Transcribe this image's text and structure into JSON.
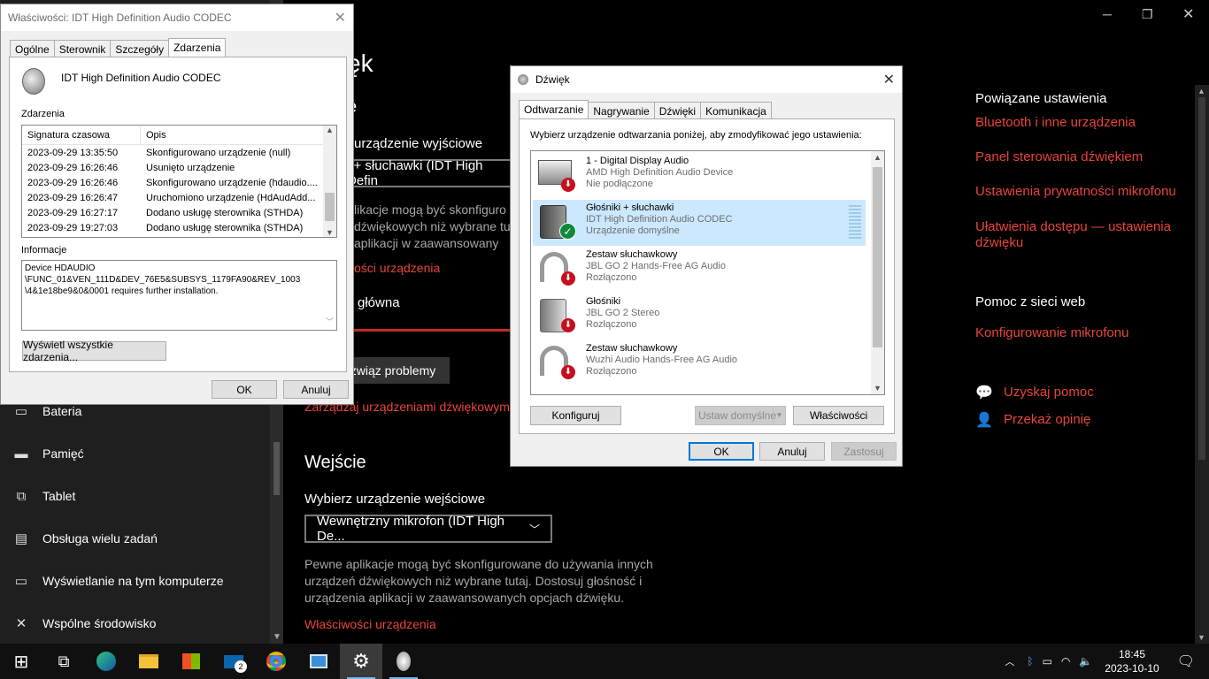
{
  "settings": {
    "heading_partial": "ęk",
    "output_section_partial": "e",
    "choose_output_partial": "urządzenie wyjściowe",
    "output_select_partial": "i + słuchawki (IDT High Defin",
    "output_desc_partial": [
      "likacje mogą być skonfiguro",
      "dźwiękowych niż wybrane tu",
      "aplikacji w zaawansowany"
    ],
    "device_props_partial": "ości urządzenia",
    "volume_partial": "główna",
    "troubleshoot_partial": "związ problemy",
    "manage_devices": "Zarządzaj urządzeniami dźwiękowymi",
    "input_heading": "Wejście",
    "choose_input": "Wybierz urządzenie wejściowe",
    "input_select": "Wewnętrzny mikrofon (IDT High De...",
    "input_desc": [
      "Pewne aplikacje mogą być skonfigurowane do używania innych",
      "urządzeń dźwiękowych niż wybrane tutaj. Dostosuj głośność i",
      "urządzenia aplikacji w zaawansowanych opcjach dźwięku."
    ],
    "input_device_props": "Właściwości urządzenia",
    "nav": [
      {
        "icon": "battery-icon",
        "label": "Bateria"
      },
      {
        "icon": "storage-icon",
        "label": "Pamięć"
      },
      {
        "icon": "tablet-icon",
        "label": "Tablet"
      },
      {
        "icon": "multitasking-icon",
        "label": "Obsługa wielu zadań"
      },
      {
        "icon": "projecting-icon",
        "label": "Wyświetlanie na tym komputerze"
      },
      {
        "icon": "shared-experience-icon",
        "label": "Wspólne środowisko"
      }
    ],
    "related": {
      "heading": "Powiązane ustawienia",
      "links": [
        "Bluetooth i inne urządzenia",
        "Panel sterowania dźwiękiem",
        "Ustawienia prywatności mikrofonu",
        "Ułatwienia dostępu — ustawienia",
        "dźwięku"
      ]
    },
    "help": {
      "heading": "Pomoc z sieci web",
      "link": "Konfigurowanie mikrofonu",
      "get_help": "Uzyskaj pomoc",
      "feedback": "Przekaż opinię"
    }
  },
  "props_dialog": {
    "title": "Właściwości: IDT High Definition Audio CODEC",
    "tabs": [
      "Ogólne",
      "Sterownik",
      "Szczegóły",
      "Zdarzenia"
    ],
    "device_name": "IDT High Definition Audio CODEC",
    "events_label": "Zdarzenia",
    "col_time": "Signatura czasowa",
    "col_desc": "Opis",
    "events": [
      {
        "t": "2023-09-29 13:35:50",
        "d": "Skonfigurowano urządzenie (null)"
      },
      {
        "t": "2023-09-29 16:26:46",
        "d": "Usunięto urządzenie"
      },
      {
        "t": "2023-09-29 16:26:46",
        "d": "Skonfigurowano urządzenie (hdaudio...."
      },
      {
        "t": "2023-09-29 16:26:47",
        "d": "Uruchomiono urządzenie (HdAudAdd..."
      },
      {
        "t": "2023-09-29 16:27:17",
        "d": "Dodano usługę sterownika (STHDA)"
      },
      {
        "t": "2023-09-29 19:27:03",
        "d": "Dodano usługę sterownika (STHDA)"
      }
    ],
    "info_label": "Informacje",
    "info_lines": [
      "Device HDAUDIO",
      "\\FUNC_01&VEN_111D&DEV_76E5&SUBSYS_1179FA90&REV_1003",
      "\\4&1e18be9&0&0001 requires further installation."
    ],
    "show_all": "Wyświetl wszystkie zdarzenia...",
    "ok": "OK",
    "cancel": "Anuluj"
  },
  "sound_dialog": {
    "title": "Dźwięk",
    "tabs": [
      "Odtwarzanie",
      "Nagrywanie",
      "Dźwięki",
      "Komunikacja"
    ],
    "instruction": "Wybierz urządzenie odtwarzania poniżej, aby zmodyfikować jego ustawienia:",
    "devices": [
      {
        "name": "1 - Digital Display Audio",
        "driver": "AMD High Definition Audio Device",
        "status": "Nie podłączone",
        "icon": "monitor-icon",
        "badge": "down"
      },
      {
        "name": "Głośniki + słuchawki",
        "driver": "IDT High Definition Audio CODEC",
        "status": "Urządzenie domyślne",
        "icon": "speaker-icon",
        "badge": "check"
      },
      {
        "name": "Zestaw słuchawkowy",
        "driver": "JBL GO 2 Hands-Free AG Audio",
        "status": "Rozłączono",
        "icon": "headset-icon",
        "badge": "down"
      },
      {
        "name": "Głośniki",
        "driver": "JBL GO 2 Stereo",
        "status": "Rozłączono",
        "icon": "speaker-icon",
        "badge": "down"
      },
      {
        "name": "Zestaw słuchawkowy",
        "driver": "Wuzhi Audio Hands-Free AG Audio",
        "status": "Rozłączono",
        "icon": "headset-icon",
        "badge": "down"
      }
    ],
    "configure": "Konfiguruj",
    "set_default": "Ustaw domyślne",
    "properties": "Właściwości",
    "ok": "OK",
    "cancel": "Anuluj",
    "apply": "Zastosuj"
  },
  "taskbar": {
    "time": "18:45",
    "date": "2023-10-10",
    "mail_badge": "2"
  }
}
